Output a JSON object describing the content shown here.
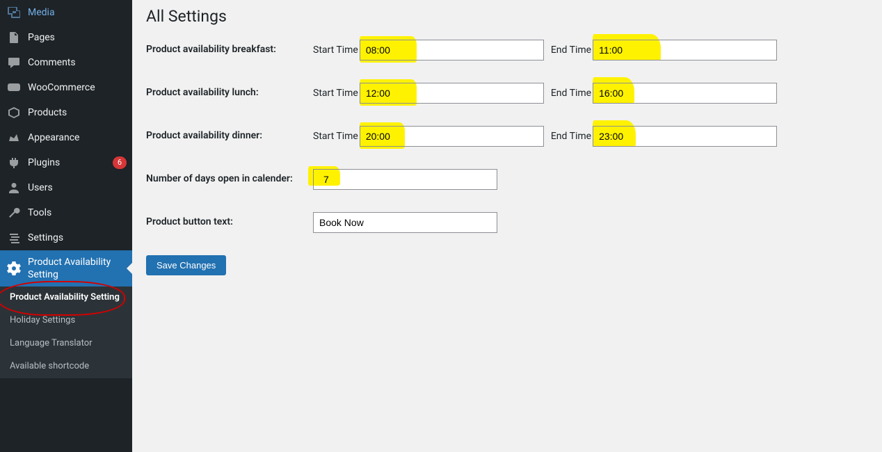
{
  "sidebar": {
    "items": [
      {
        "label": "Media",
        "icon": "media-icon"
      },
      {
        "label": "Pages",
        "icon": "pages-icon"
      },
      {
        "label": "Comments",
        "icon": "comments-icon"
      },
      {
        "label": "WooCommerce",
        "icon": "woo-icon"
      },
      {
        "label": "Products",
        "icon": "products-icon"
      },
      {
        "label": "Appearance",
        "icon": "appearance-icon"
      },
      {
        "label": "Plugins",
        "icon": "plugins-icon",
        "badge": "6"
      },
      {
        "label": "Users",
        "icon": "users-icon"
      },
      {
        "label": "Tools",
        "icon": "tools-icon"
      },
      {
        "label": "Settings",
        "icon": "settings-icon"
      }
    ],
    "active": {
      "label": "Product Availability Setting",
      "icon": "gear-icon"
    },
    "submenu": [
      {
        "label": "Product Availability Setting",
        "current": true
      },
      {
        "label": "Holiday Settings"
      },
      {
        "label": "Language Translator"
      },
      {
        "label": "Available shortcode"
      }
    ]
  },
  "page": {
    "title": "All Settings",
    "rows": {
      "breakfast": {
        "label": "Product availability breakfast:",
        "start_label": "Start Time",
        "start_value": "08:00",
        "end_label": "End Time",
        "end_value": "11:00"
      },
      "lunch": {
        "label": "Product availability lunch:",
        "start_label": "Start Time",
        "start_value": "12:00",
        "end_label": "End Time",
        "end_value": "16:00"
      },
      "dinner": {
        "label": "Product availability dinner:",
        "start_label": "Start Time",
        "start_value": "20:00",
        "end_label": "End Time",
        "end_value": "23:00"
      },
      "days": {
        "label": "Number of days open in calender:",
        "value": "7"
      },
      "button_text": {
        "label": "Product button text:",
        "value": "Book Now"
      }
    },
    "save_label": "Save Changes"
  }
}
